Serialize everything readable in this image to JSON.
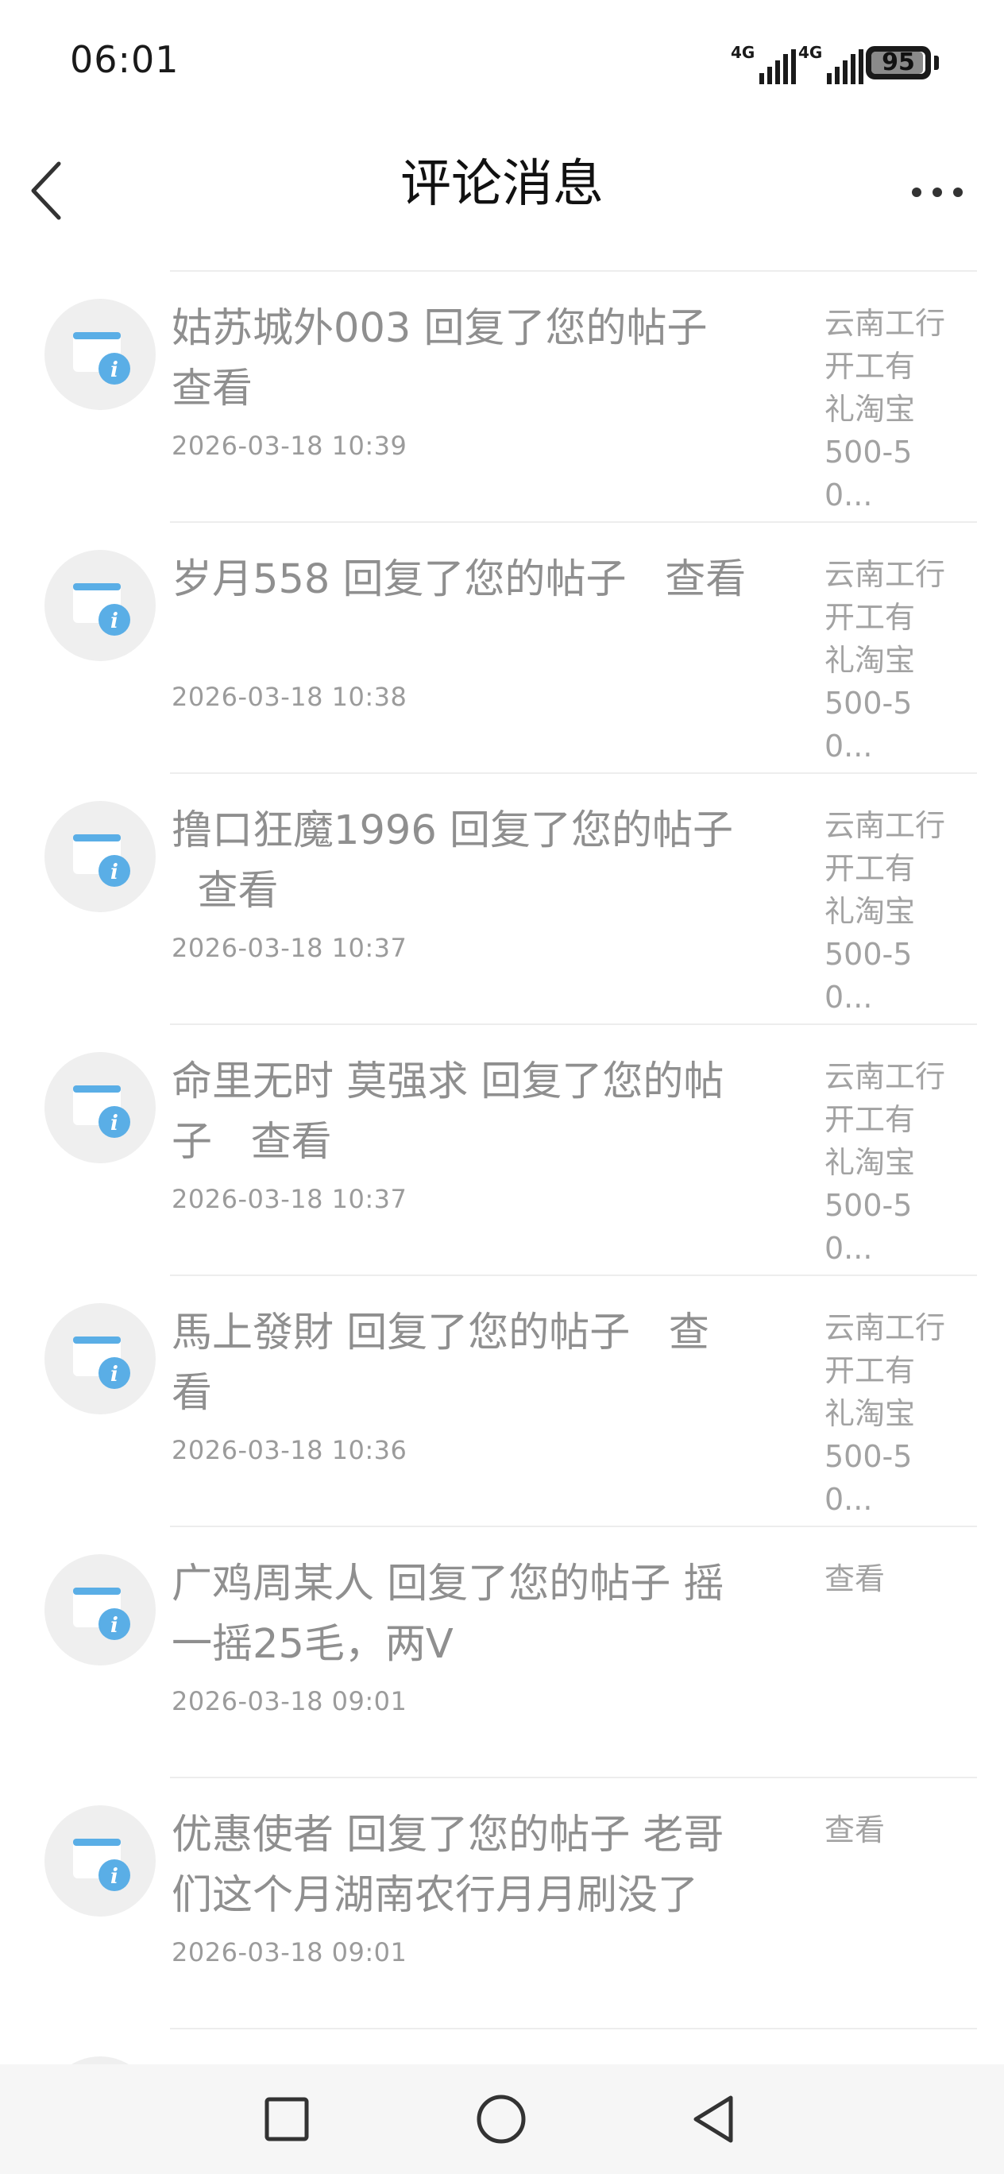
{
  "status_bar": {
    "time": "06:01",
    "signal_1": "4G",
    "signal_2": "4G",
    "battery": "95"
  },
  "header": {
    "title": "评论消息"
  },
  "messages": [
    {
      "text": "姑苏城外003 回复了您的帖子\n查看",
      "time": "2026-03-18 10:39",
      "preview": "云南工行\n开工有\n礼淘宝\n500-50..."
    },
    {
      "text": "岁月558 回复了您的帖子   查看",
      "time": "2026-03-18 10:38",
      "preview": "云南工行\n开工有\n礼淘宝\n500-50..."
    },
    {
      "text": "撸口狂魔1996 回复了您的帖子\n  查看",
      "time": "2026-03-18 10:37",
      "preview": "云南工行\n开工有\n礼淘宝\n500-50..."
    },
    {
      "text": "命里无时 莫强求 回复了您的帖\n子   查看",
      "time": "2026-03-18 10:37",
      "preview": "云南工行\n开工有\n礼淘宝\n500-50..."
    },
    {
      "text": "馬上發財 回复了您的帖子   查\n看",
      "time": "2026-03-18 10:36",
      "preview": "云南工行\n开工有\n礼淘宝\n500-50..."
    },
    {
      "text": "广鸡周某人 回复了您的帖子 摇\n一摇25毛，两V",
      "time": "2026-03-18 09:01",
      "preview": "查看"
    },
    {
      "text": "优惠使者 回复了您的帖子 老哥\n们这个月湖南农行月月刷没了",
      "time": "2026-03-18 09:01",
      "preview": "查看"
    }
  ],
  "colors": {
    "message_text": "#8f8f8f",
    "icon_blue": "#5aaee6",
    "avatar_bg": "#efefef"
  },
  "icons": {
    "back": "chevron-left-icon",
    "more": "more-dots-icon",
    "avatar": "notification-info-icon",
    "nav_recent": "square-icon",
    "nav_home": "circle-icon",
    "nav_back": "triangle-back-icon"
  }
}
